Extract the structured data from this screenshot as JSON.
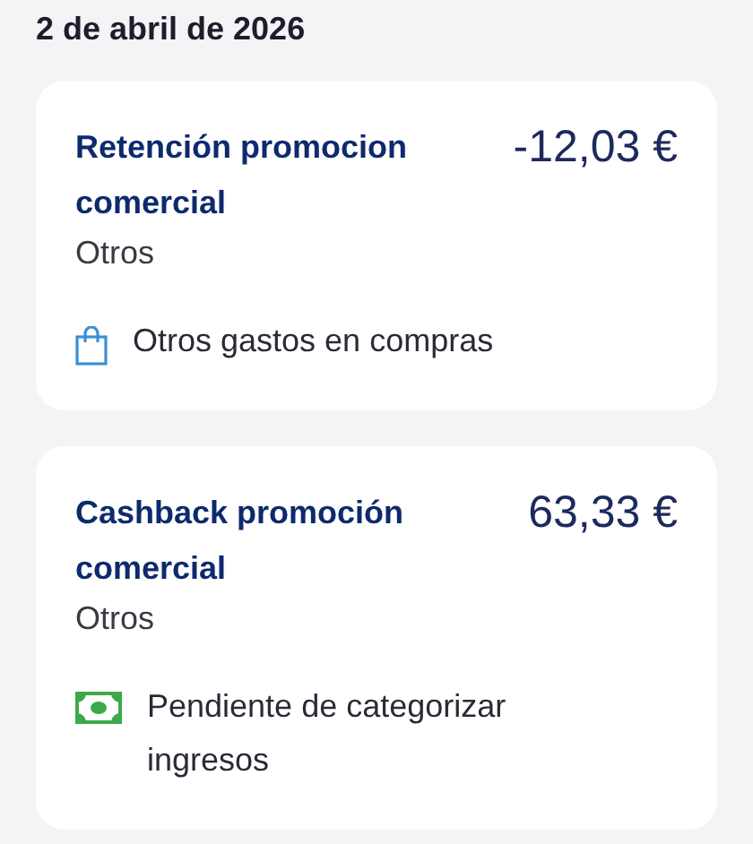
{
  "date_header": "2 de abril de 2026",
  "transactions": [
    {
      "title": "Retención promocion comercial",
      "amount": "-12,03 €",
      "subcategory": "Otros",
      "category": {
        "kind": "expense",
        "label": "Otros gastos en compras"
      }
    },
    {
      "title": "Cashback promoción comercial",
      "amount": "63,33 €",
      "subcategory": "Otros",
      "category": {
        "kind": "income",
        "label": "Pendiente de categorizar ingresos"
      }
    }
  ]
}
